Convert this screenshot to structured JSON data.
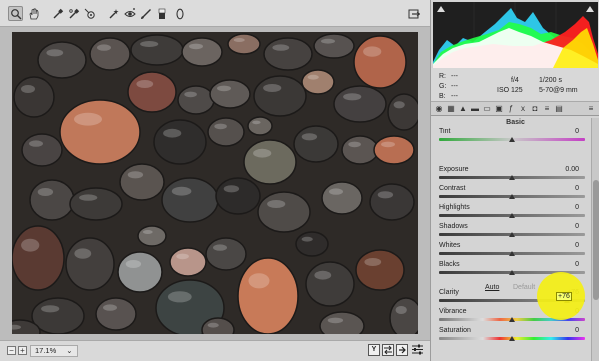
{
  "toolbar": {
    "tools": [
      "zoom-tool",
      "hand-tool",
      "white-balance-tool",
      "color-sampler-tool",
      "targeted-adjustment-tool",
      "crop-tool",
      "spot-removal-tool",
      "red-eye-tool",
      "adjustment-brush-tool",
      "graduated-filter-tool",
      "radial-filter-tool"
    ],
    "active_tool": "zoom-tool"
  },
  "status": {
    "zoom": "17.1%",
    "zoom_arrow": "⌄",
    "view_buttons": [
      "Y"
    ]
  },
  "readout": {
    "r_label": "R:",
    "g_label": "G:",
    "b_label": "B:",
    "r": "---",
    "g": "---",
    "b": "---",
    "aperture": "f/4",
    "shutter": "1/200 s",
    "iso": "ISO 125",
    "lens": "5-70@9 mm"
  },
  "panel": {
    "section": "Basic",
    "auto": "Auto",
    "default": "Default"
  },
  "sliders": [
    {
      "label": "Tint",
      "value": "0",
      "pos": 0.5,
      "track": "tint"
    },
    {
      "label": "Exposure",
      "value": "0.00",
      "pos": 0.5,
      "track": "gray"
    },
    {
      "label": "Contrast",
      "value": "0",
      "pos": 0.5,
      "track": "gray"
    },
    {
      "label": "Highlights",
      "value": "0",
      "pos": 0.5,
      "track": "gray"
    },
    {
      "label": "Shadows",
      "value": "0",
      "pos": 0.5,
      "track": "gray"
    },
    {
      "label": "Whites",
      "value": "0",
      "pos": 0.5,
      "track": "gray"
    },
    {
      "label": "Blacks",
      "value": "0",
      "pos": 0.5,
      "track": "gray"
    },
    {
      "label": "Clarity",
      "value": "+76",
      "pos": 0.88,
      "track": "gray"
    },
    {
      "label": "Vibrance",
      "value": "0",
      "pos": 0.5,
      "track": "vibrance"
    },
    {
      "label": "Saturation",
      "value": "0",
      "pos": 0.5,
      "track": "saturation"
    }
  ],
  "colors": {
    "highlight": "#f4ef16",
    "panel": "#d4d4d4",
    "histogram_bg": "#1f1f1f"
  }
}
